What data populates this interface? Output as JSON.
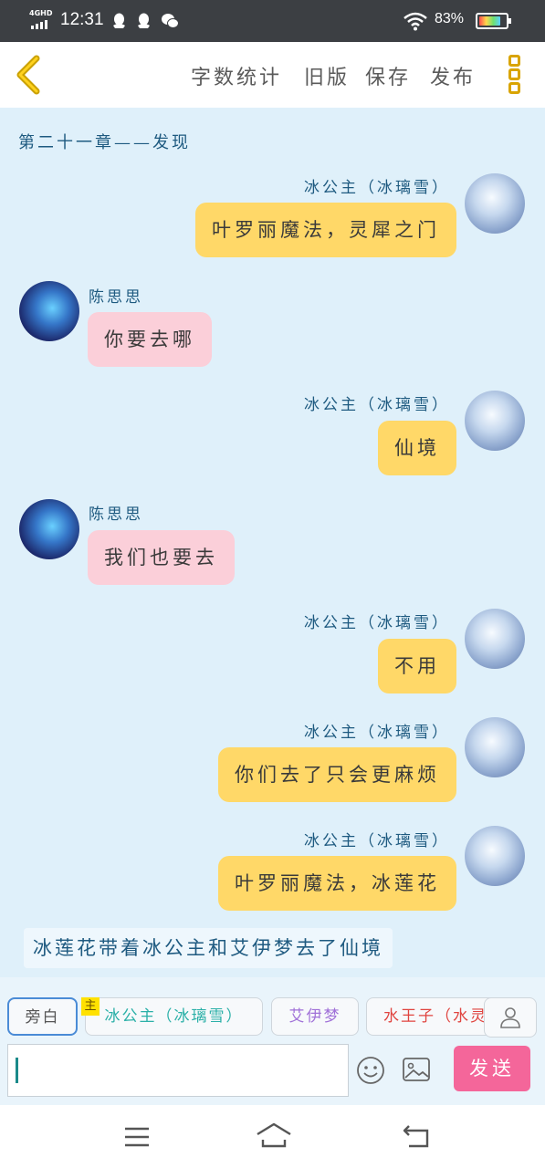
{
  "status_bar": {
    "network": "4GHD",
    "time": "12:31",
    "battery_text": "83%",
    "battery_level": 0.83
  },
  "toolbar": {
    "word_count": "字数统计",
    "old_version": "旧版",
    "save": "保存",
    "publish": "发布"
  },
  "chapter_title": "第二十一章——发现",
  "messages": [
    {
      "speaker": "冰公主（冰璃雪）",
      "text": "叶罗丽魔法，灵犀之门",
      "side": "right",
      "color": "#ffd868"
    },
    {
      "speaker": "陈思思",
      "text": "你要去哪",
      "side": "left",
      "color": "#fbcfd9"
    },
    {
      "speaker": "冰公主（冰璃雪）",
      "text": "仙境",
      "side": "right",
      "color": "#ffd868"
    },
    {
      "speaker": "陈思思",
      "text": "我们也要去",
      "side": "left",
      "color": "#fbcfd9"
    },
    {
      "speaker": "冰公主（冰璃雪）",
      "text": "不用",
      "side": "right",
      "color": "#ffd868"
    },
    {
      "speaker": "冰公主（冰璃雪）",
      "text": "你们去了只会更麻烦",
      "side": "right",
      "color": "#ffd868"
    },
    {
      "speaker": "冰公主（冰璃雪）",
      "text": "叶罗丽魔法，冰莲花",
      "side": "right",
      "color": "#ffd868"
    }
  ],
  "narration": "冰莲花带着冰公主和艾伊梦去了仙境",
  "characters": {
    "narrator": "旁白",
    "main_badge": "主",
    "c1": "冰公主（冰璃雪）",
    "c2": "艾伊梦",
    "c3": "水王子（水灵"
  },
  "input": {
    "value": ""
  },
  "send_label": "发送",
  "colors": {
    "accent_yellow": "#d9a400",
    "send": "#f4669a",
    "chat_bg": "#dff0fa"
  }
}
